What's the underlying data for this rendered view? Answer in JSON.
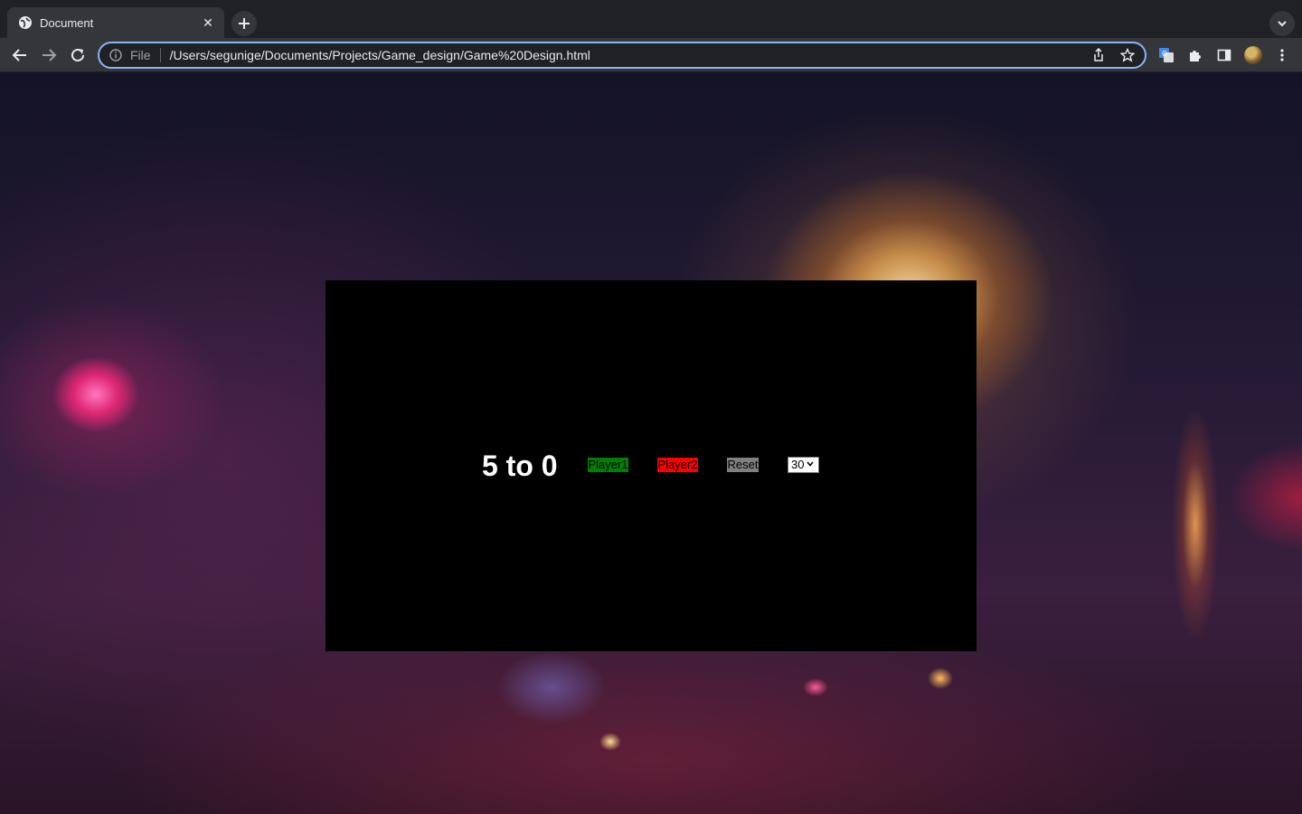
{
  "browser": {
    "tab_title": "Document",
    "url_scheme": "File",
    "url": "/Users/segunige/Documents/Projects/Game_design/Game%20Design.html",
    "accent_color": "#8ab4f8"
  },
  "game": {
    "score_text": "5 to 0",
    "player1_label": "Player1",
    "player2_label": "Player2",
    "reset_label": "Reset",
    "winning_score_selected": "30",
    "colors": {
      "player1": "#008000",
      "player2": "#ff0000",
      "reset": "#808080"
    }
  }
}
